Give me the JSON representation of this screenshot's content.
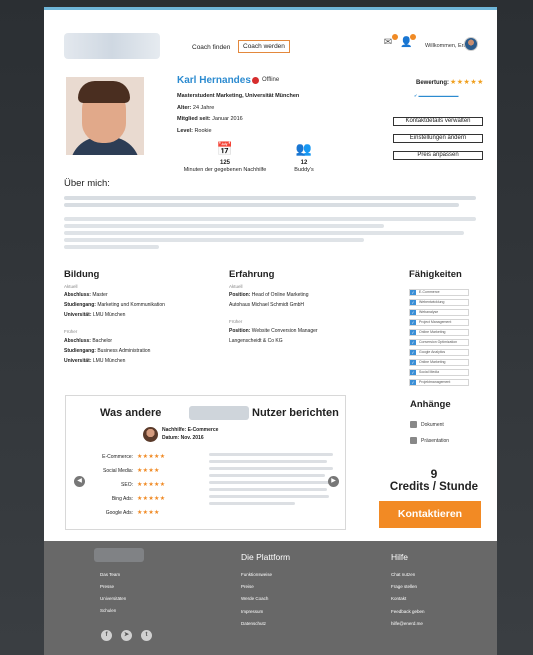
{
  "header": {
    "nav": [
      "Coach finden",
      "Coach werden"
    ],
    "welcome": "Willkommen, Eric"
  },
  "profile": {
    "name": "Karl Hernandes",
    "status": "Offline",
    "degree": "Masterstudent Marketing, Universität München",
    "age_label": "Alter:",
    "age": "24 Jahre",
    "member_label": "Mitglied seit:",
    "member_since": "Januar 2016",
    "level_label": "Level:",
    "level": "Rookie",
    "minutes_value": "125",
    "minutes_label": "Minuten der gegebenen Nachhilfe",
    "buddies_value": "12",
    "buddies_label": "Buddy's"
  },
  "rating": {
    "label": "Bewertung:",
    "stars": "★★★★★",
    "star_count": 5
  },
  "sidebar_buttons": [
    "Kontaktdetails verwalten",
    "Einstellungen ändern",
    "Preis anpassen"
  ],
  "about": {
    "title": "Über mich:"
  },
  "education": {
    "title": "Bildung",
    "current_label": "Aktuell",
    "current": [
      {
        "k": "Abschluss:",
        "v": "Master"
      },
      {
        "k": "Studiengang:",
        "v": "Marketing und Kommunikation"
      },
      {
        "k": "Universität:",
        "v": "LMU München"
      }
    ],
    "past_label": "Früher",
    "past": [
      {
        "k": "Abschluss:",
        "v": "Bachelor"
      },
      {
        "k": "Studiengang:",
        "v": "Business Administration"
      },
      {
        "k": "Universität:",
        "v": "LMU München"
      }
    ]
  },
  "experience": {
    "title": "Erfahrung",
    "current_label": "Aktuell",
    "current": [
      {
        "k": "Position:",
        "v": "Head of Online Marketing"
      },
      {
        "k": "",
        "v": "Autohaus Michael Schmidt GmbH"
      }
    ],
    "past_label": "Früher",
    "past": [
      {
        "k": "Position:",
        "v": "Website Conversion Manager"
      },
      {
        "k": "",
        "v": "Langenscheidt & Co KG"
      }
    ]
  },
  "skills": {
    "title": "Fähigkeiten",
    "items": [
      "E-Commerce",
      "Webentwicklung",
      "Webanalyse",
      "Project Management",
      "Online Marketing",
      "Conversion Optimization",
      "Google Analytics",
      "Online Marketing",
      "Social Media",
      "Projektmanagement"
    ]
  },
  "attachments": {
    "title": "Anhänge",
    "items": [
      "Dokument",
      "Präsentation"
    ]
  },
  "reviews": {
    "title_prefix": "Was andere",
    "title_suffix": "Nutzer berichten",
    "tutoring_label": "Nachhilfe:",
    "tutoring": "E-Commerce",
    "date_label": "Datum:",
    "date": "Nov. 2016",
    "criteria": [
      {
        "label": "E-Commerce:",
        "stars": "★★★★★"
      },
      {
        "label": "Social Media:",
        "stars": "★★★★"
      },
      {
        "label": "SEO:",
        "stars": "★★★★★"
      },
      {
        "label": "Bing Ads:",
        "stars": "★★★★★"
      },
      {
        "label": "Google Ads:",
        "stars": "★★★★"
      }
    ]
  },
  "pricing": {
    "credits": "9",
    "unit": "Credits / Stunde",
    "cta": "Kontaktieren"
  },
  "footer": {
    "col1": [
      "Das Team",
      "Presse",
      "Universitäten",
      "Schulen"
    ],
    "col2_title": "Die Plattform",
    "col2": [
      "Funktionsweise",
      "Preise",
      "Werde Coach",
      "Impressum",
      "Datenschutz"
    ],
    "col3_title": "Hilfe",
    "col3": [
      "Chat nutzen",
      "Frage stellen",
      "Kontakt",
      "Feedback geben",
      "hilfe@enerd.me"
    ]
  },
  "colors": {
    "accent": "#f28a24",
    "link": "#2c8bd0",
    "footer": "#686868"
  }
}
